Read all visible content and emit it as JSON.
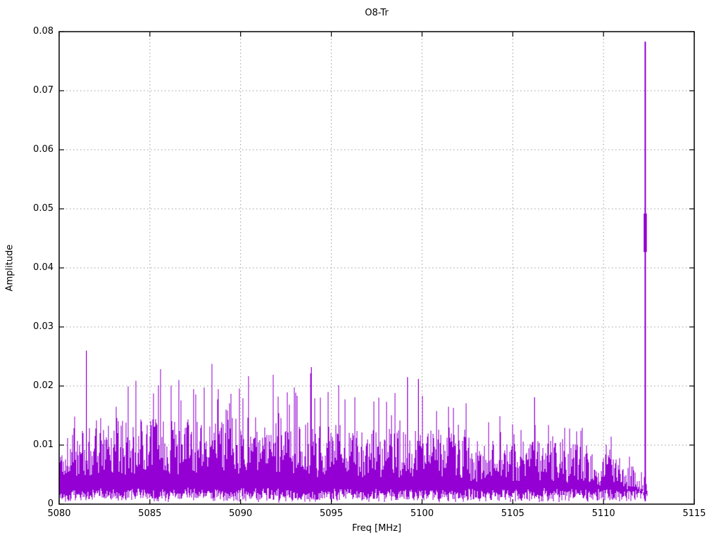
{
  "chart_data": {
    "type": "line",
    "title": "O8-Tr",
    "xlabel": "Freq [MHz]",
    "ylabel": "Amplitude",
    "xlim": [
      5080,
      5115
    ],
    "ylim": [
      0,
      0.08
    ],
    "xticks": [
      5080,
      5085,
      5090,
      5095,
      5100,
      5105,
      5110,
      5115
    ],
    "xtick_labels": [
      "5080",
      "5085",
      "5090",
      "5095",
      "5100",
      "5105",
      "5110",
      "5115"
    ],
    "yticks": [
      0,
      0.01,
      0.02,
      0.03,
      0.04,
      0.05,
      0.06,
      0.07,
      0.08
    ],
    "ytick_labels": [
      "0",
      "0.01",
      "0.02",
      "0.03",
      "0.04",
      "0.05",
      "0.06",
      "0.07",
      "0.08"
    ],
    "grid": true,
    "legend": "none",
    "series_color": "#9400d3",
    "grid_color": "#9e9e9e",
    "border_color": "#000000",
    "noise_band": {
      "x_start": 5080.0,
      "x_end": 5112.4,
      "seed": 1337,
      "floor": 0.0008,
      "envelope": [
        {
          "x": 5080.0,
          "dense": 0.01,
          "peak": 0.014
        },
        {
          "x": 5081.0,
          "dense": 0.012,
          "peak": 0.02
        },
        {
          "x": 5082.5,
          "dense": 0.013,
          "peak": 0.022
        },
        {
          "x": 5085.0,
          "dense": 0.013,
          "peak": 0.023
        },
        {
          "x": 5088.0,
          "dense": 0.013,
          "peak": 0.024
        },
        {
          "x": 5091.0,
          "dense": 0.013,
          "peak": 0.024
        },
        {
          "x": 5094.0,
          "dense": 0.012,
          "peak": 0.023
        },
        {
          "x": 5097.0,
          "dense": 0.012,
          "peak": 0.02
        },
        {
          "x": 5100.0,
          "dense": 0.011,
          "peak": 0.02
        },
        {
          "x": 5103.0,
          "dense": 0.01,
          "peak": 0.017
        },
        {
          "x": 5106.0,
          "dense": 0.01,
          "peak": 0.016
        },
        {
          "x": 5109.0,
          "dense": 0.009,
          "peak": 0.013
        },
        {
          "x": 5111.0,
          "dense": 0.007,
          "peak": 0.011
        },
        {
          "x": 5112.0,
          "dense": 0.005,
          "peak": 0.007
        },
        {
          "x": 5112.4,
          "dense": 0.004,
          "peak": 0.006
        }
      ],
      "extra_peaks": [
        {
          "x": 5081.5,
          "y": 0.026
        },
        {
          "x": 5093.9,
          "y": 0.0232
        },
        {
          "x": 5099.2,
          "y": 0.0215
        },
        {
          "x": 5099.8,
          "y": 0.0212
        },
        {
          "x": 5106.2,
          "y": 0.0181
        }
      ]
    },
    "spike": {
      "x": 5112.3,
      "peak": 0.0783,
      "cluster_low": 0.0427,
      "cluster_high": 0.0492
    }
  }
}
